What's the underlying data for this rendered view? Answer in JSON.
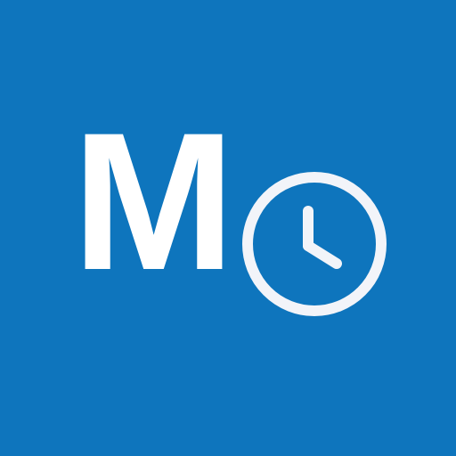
{
  "icon": {
    "letter": "M",
    "background_color": "#0e75bd",
    "foreground_color": "#ffffff",
    "clock_stroke_color": "#f2f4f9",
    "symbol": "clock-icon"
  }
}
